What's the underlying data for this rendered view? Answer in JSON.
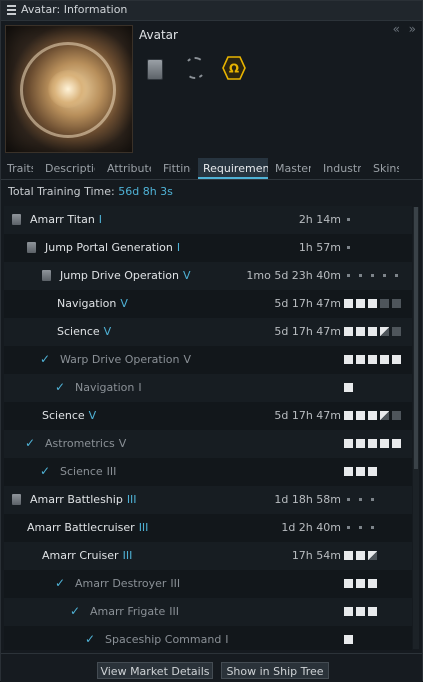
{
  "window": {
    "title": "Avatar: Information",
    "collapse_glyphs": [
      "«",
      "»"
    ]
  },
  "ship": {
    "name": "Avatar"
  },
  "tabs": [
    {
      "label": "Traits"
    },
    {
      "label": "Description"
    },
    {
      "label": "Attributes"
    },
    {
      "label": "Fitting"
    },
    {
      "label": "Requirements",
      "active": true
    },
    {
      "label": "Mastery"
    },
    {
      "label": "Industry"
    },
    {
      "label": "Skins"
    }
  ],
  "total_training": {
    "label": "Total Training Time:",
    "value": "56d 8h 3s"
  },
  "skills": [
    {
      "name": "Amarr Titan",
      "level": "I",
      "time": "2h 14m",
      "state": "book",
      "boxes": "dots1"
    },
    {
      "name": "Jump Portal Generation",
      "level": "I",
      "time": "1h 57m",
      "state": "book",
      "boxes": "dots1"
    },
    {
      "name": "Jump Drive Operation",
      "level": "V",
      "time": "1mo 5d 23h 40m",
      "state": "book",
      "boxes": "dots5"
    },
    {
      "name": "Navigation",
      "level": "V",
      "time": "5d 17h 47m",
      "state": "none",
      "trained": 3
    },
    {
      "name": "Science",
      "level": "V",
      "time": "5d 17h 47m",
      "state": "none",
      "trained": 3.5
    },
    {
      "name": "Warp Drive Operation",
      "level": "V",
      "time": "",
      "state": "check",
      "trained": 5
    },
    {
      "name": "Navigation",
      "level": "I",
      "time": "",
      "state": "check",
      "trained": 1,
      "max": 1
    },
    {
      "name": "Science",
      "level": "V",
      "time": "5d 17h 47m",
      "state": "none",
      "trained": 3.5
    },
    {
      "name": "Astrometrics",
      "level": "V",
      "time": "",
      "state": "check",
      "trained": 5
    },
    {
      "name": "Science",
      "level": "III",
      "time": "",
      "state": "check",
      "trained": 3,
      "max": 3
    },
    {
      "name": "Amarr Battleship",
      "level": "III",
      "time": "1d 18h 58m",
      "state": "book",
      "boxes": "dots3"
    },
    {
      "name": "Amarr Battlecruiser",
      "level": "III",
      "time": "1d 2h 40m",
      "state": "none",
      "boxes": "dots3"
    },
    {
      "name": "Amarr Cruiser",
      "level": "III",
      "time": "17h 54m",
      "state": "none",
      "trained": 2.5,
      "max": 3
    },
    {
      "name": "Amarr Destroyer",
      "level": "III",
      "time": "",
      "state": "check",
      "trained": 3,
      "max": 3
    },
    {
      "name": "Amarr Frigate",
      "level": "III",
      "time": "",
      "state": "check",
      "trained": 3,
      "max": 3
    },
    {
      "name": "Spaceship Command",
      "level": "I",
      "time": "",
      "state": "check",
      "trained": 1,
      "max": 1
    }
  ],
  "footer": {
    "market_button": "View Market Details",
    "tree_button": "Show in Ship Tree"
  },
  "colors": {
    "accent": "#4fb2d6",
    "omega": "#e8b400"
  }
}
